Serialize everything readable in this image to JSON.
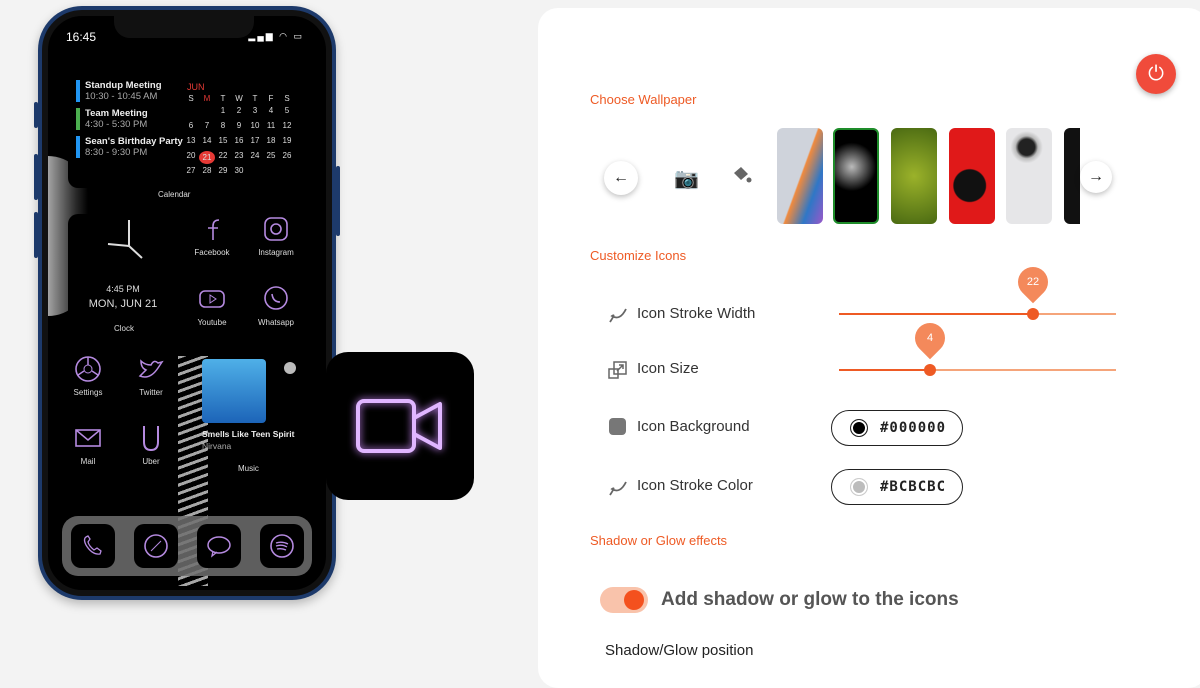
{
  "phone": {
    "status_time": "16:45",
    "events": [
      {
        "title": "Standup Meeting",
        "time": "10:30 - 10:45 AM",
        "color": "#2196f3"
      },
      {
        "title": "Team Meeting",
        "time": "4:30 - 5:30 PM",
        "color": "#4caf50"
      },
      {
        "title": "Sean's Birthday Party",
        "time": "8:30 - 9:30 PM",
        "color": "#2196f3"
      }
    ],
    "calendar": {
      "month": "JUN",
      "weekdays": [
        "S",
        "M",
        "T",
        "W",
        "T",
        "F",
        "S"
      ],
      "weeks": [
        [
          "",
          "",
          "1",
          "2",
          "3",
          "4",
          "5"
        ],
        [
          "6",
          "7",
          "8",
          "9",
          "10",
          "11",
          "12"
        ],
        [
          "13",
          "14",
          "15",
          "16",
          "17",
          "18",
          "19"
        ],
        [
          "20",
          "21",
          "22",
          "23",
          "24",
          "25",
          "26"
        ],
        [
          "27",
          "28",
          "29",
          "30",
          "",
          "",
          ""
        ]
      ],
      "today": "21",
      "label": "Calendar"
    },
    "clock": {
      "time": "4:45 PM",
      "date": "MON, JUN 21",
      "label": "Clock"
    },
    "apps": [
      {
        "label": "Facebook",
        "icon": "facebook-icon"
      },
      {
        "label": "Instagram",
        "icon": "instagram-icon"
      },
      {
        "label": "Youtube",
        "icon": "youtube-icon"
      },
      {
        "label": "Whatsapp",
        "icon": "whatsapp-icon"
      },
      {
        "label": "Settings",
        "icon": "settings-icon"
      },
      {
        "label": "Twitter",
        "icon": "twitter-icon"
      },
      {
        "label": "Mail",
        "icon": "mail-icon"
      },
      {
        "label": "Uber",
        "icon": "uber-icon"
      }
    ],
    "music": {
      "song": "Smells Like Teen Spirit",
      "artist": "Nirvana",
      "label": "Music"
    },
    "dock": [
      "phone-icon",
      "compass-icon",
      "message-icon",
      "spotify-icon"
    ],
    "icon_color": "#b58ae0"
  },
  "preview_icon": "video-camera-icon",
  "panel": {
    "accent": "#ee5a24",
    "wallpaper_title": "Choose Wallpaper",
    "customize_title": "Customize Icons",
    "stroke_width": {
      "label": "Icon Stroke Width",
      "value": "22",
      "fill_percent": 70
    },
    "icon_size": {
      "label": "Icon Size",
      "value": "4",
      "fill_percent": 33
    },
    "background": {
      "label": "Icon Background",
      "value": "#000000"
    },
    "stroke_color": {
      "label": "Icon Stroke Color",
      "value": "#BCBCBC"
    },
    "shadow_title": "Shadow or Glow effects",
    "shadow_toggle": {
      "label": "Add shadow or glow to the icons",
      "on": true
    },
    "shadow_position_label": "Shadow/Glow position"
  }
}
